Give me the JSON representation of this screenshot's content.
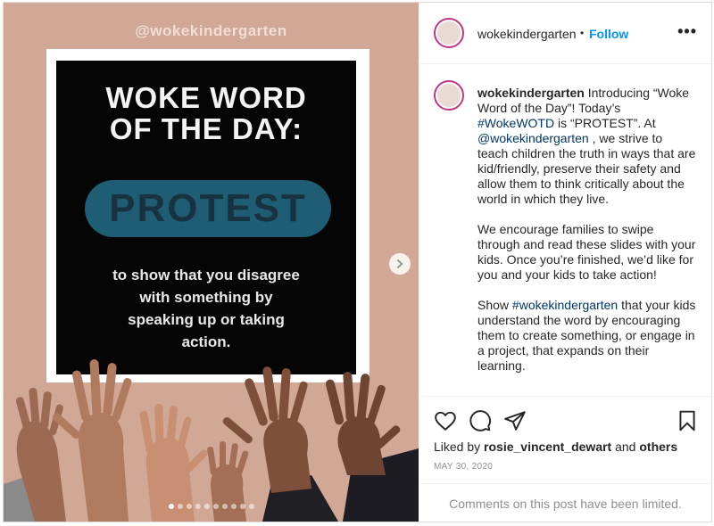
{
  "post": {
    "watermark": "@wokekindergarten",
    "slide": {
      "title_line1": "WOKE WORD",
      "title_line2": "OF THE DAY:",
      "word": "PROTEST",
      "definition_line1": "to show that you disagree",
      "definition_line2": "with something by",
      "definition_line3": "speaking up or taking",
      "definition_line4": "action."
    },
    "carousel": {
      "total_slides": 10,
      "active_index": 0
    }
  },
  "header": {
    "username": "wokekindergarten",
    "separator": "•",
    "follow_label": "Follow",
    "more_label": "•••"
  },
  "caption": {
    "username": "wokekindergarten",
    "p1_a": " Introducing “Woke Word of the Day”! Today’s ",
    "p1_tag": "#WokeWOTD",
    "p1_b": " is “PROTEST”. At ",
    "p1_mention": "@wokekindergarten",
    "p1_c": " , we strive to teach children the truth in ways that are kid/friendly, preserve their safety and allow them to think critically about the world in which they live.",
    "p2": "We encourage families to swipe through and read these slides with your kids. Once you’re finished, we’d like for you and your kids to take action!",
    "p3_a": "Show ",
    "p3_tag": "#wokekindergarten",
    "p3_b": " that your kids understand the word by encouraging them to create something, or engage in a project, that expands on their learning."
  },
  "footer": {
    "liked_prefix": "Liked by ",
    "liked_user": "rosie_vincent_dewart",
    "liked_and": " and ",
    "liked_others": "others",
    "date": "MAY 30, 2020",
    "comments_limited": "Comments on this post have been limited."
  },
  "icons": {
    "like": "heart-icon",
    "comment": "comment-icon",
    "share": "paper-plane-icon",
    "save": "bookmark-icon",
    "next": "chevron-right-icon"
  },
  "colors": {
    "follow": "#0095f6",
    "hashtag": "#00376b",
    "image_background": "#d1a796",
    "highlight": "#1e5d73"
  }
}
